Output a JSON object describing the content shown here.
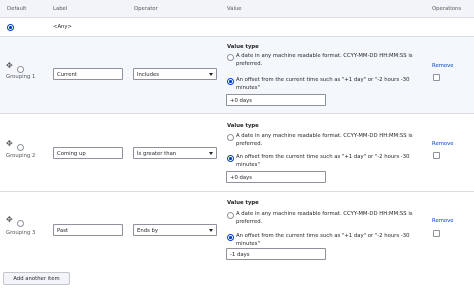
{
  "header": {
    "default": "Default",
    "label": "Label",
    "operator": "Operator",
    "value": "Value",
    "operations": "Operations"
  },
  "any_row": {
    "label": "<Any>"
  },
  "groups": [
    {
      "name": "Grouping 1",
      "label_value": "Current",
      "operator": "Includes",
      "value_type_title": "Value type",
      "option_date": "A date in any machine readable format. CCYY-MM-DD HH:MM:SS is preferred.",
      "option_offset": "An offset from the current time such as \"+1 day\" or \"-2 hours -30 minutes\"",
      "value": "+0 days",
      "remove": "Remove"
    },
    {
      "name": "Grouping 2",
      "label_value": "Coming up",
      "operator": "Is greater than",
      "value_type_title": "Value type",
      "option_date": "A date in any machine readable format. CCYY-MM-DD HH:MM:SS is preferred.",
      "option_offset": "An offset from the current time such as \"+1 day\" or \"-2 hours -30 minutes\"",
      "value": "+0 days",
      "remove": "Remove"
    },
    {
      "name": "Grouping 3",
      "label_value": "Past",
      "operator": "Ends by",
      "value_type_title": "Value type",
      "option_date": "A date in any machine readable format. CCYY-MM-DD HH:MM:SS is preferred.",
      "option_offset": "An offset from the current time such as \"+1 day\" or \"-2 hours -30 minutes\"",
      "value": "-1 days",
      "remove": "Remove"
    }
  ],
  "add_button": "Add another item",
  "colors": {
    "accent": "#003ecc",
    "row_alt": "#f4f8fd",
    "header_bg": "#f3f4f9"
  }
}
